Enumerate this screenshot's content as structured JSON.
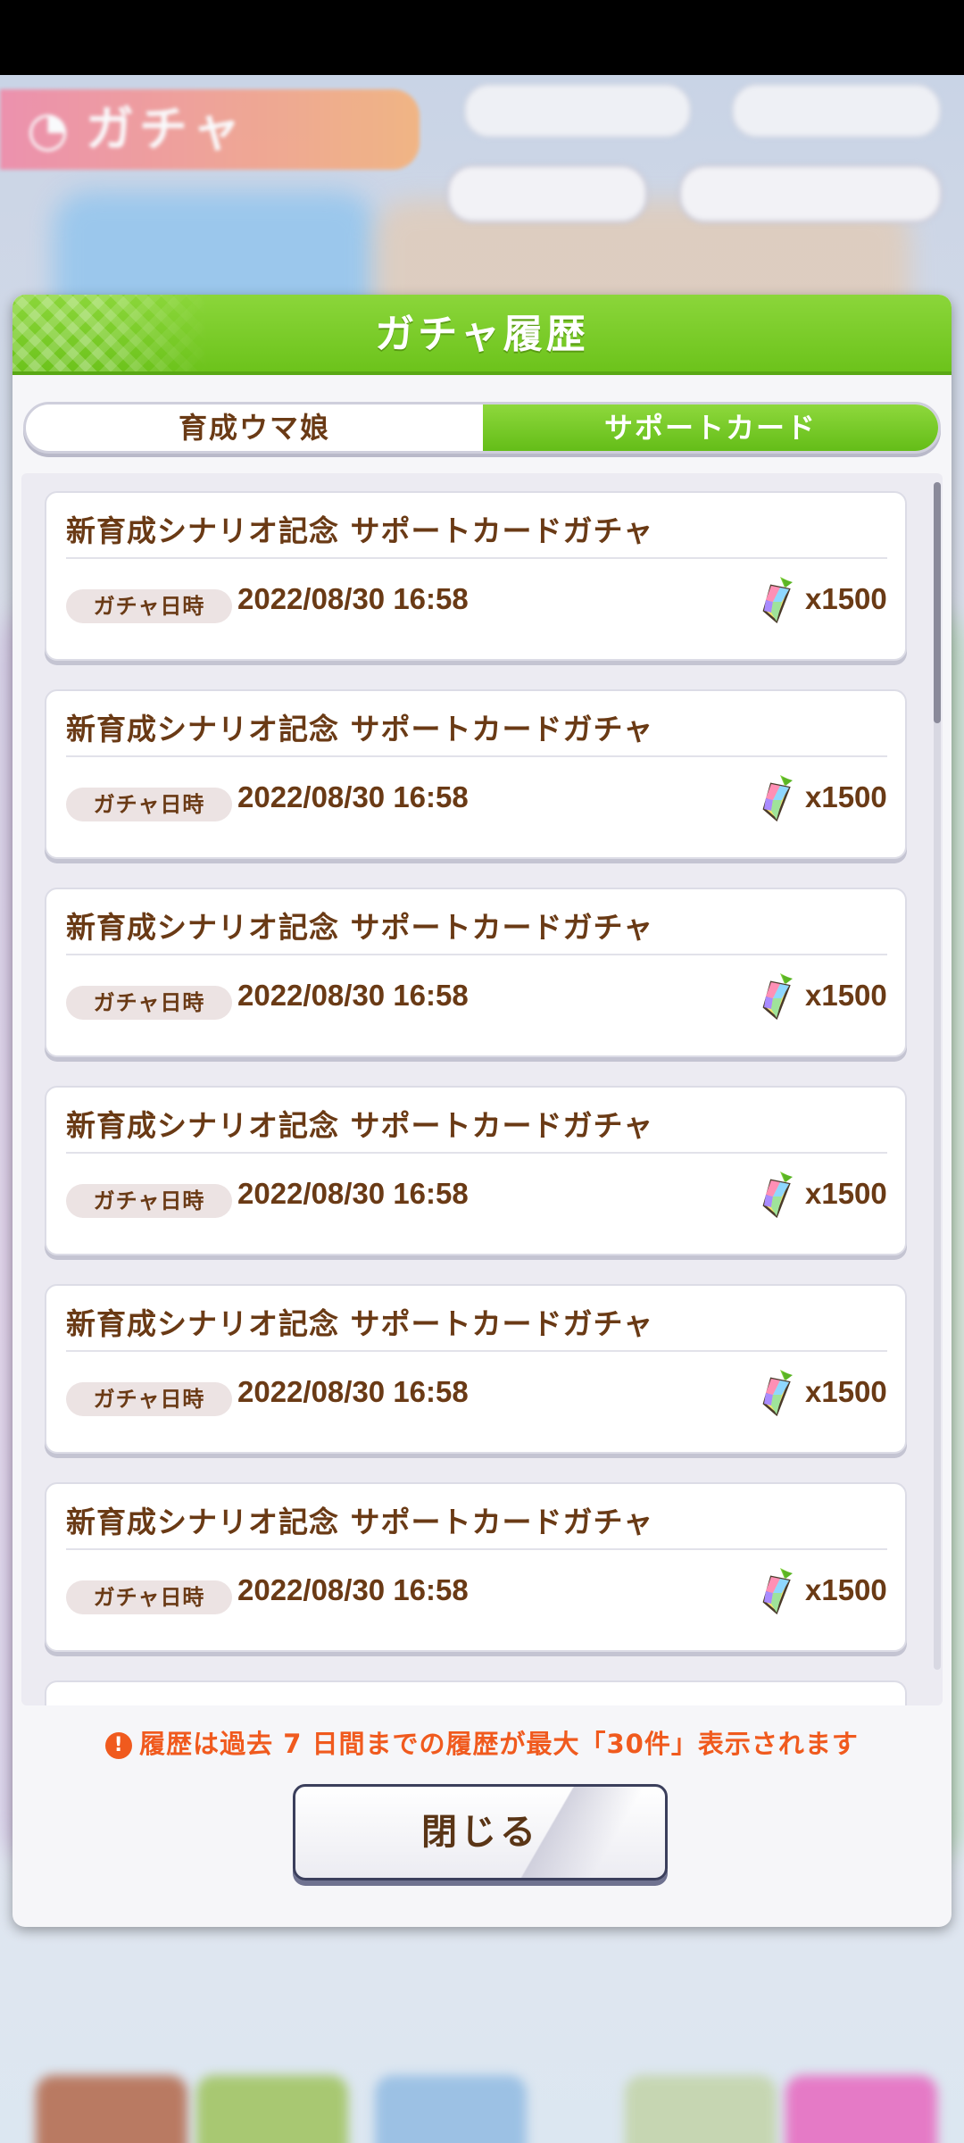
{
  "background": {
    "screen_title": "ガチャ"
  },
  "modal": {
    "title": "ガチャ履歴",
    "tabs": [
      {
        "label": "育成ウマ娘",
        "active": false
      },
      {
        "label": "サポートカード",
        "active": true
      }
    ],
    "history_items": [
      {
        "title": "新育成シナリオ記念 サポートカードガチャ",
        "date_label": "ガチャ日時",
        "datetime": "2022/08/30 16:58",
        "cost": "x1500",
        "cost_icon": "carrot-jewel-icon"
      },
      {
        "title": "新育成シナリオ記念 サポートカードガチャ",
        "date_label": "ガチャ日時",
        "datetime": "2022/08/30 16:58",
        "cost": "x1500",
        "cost_icon": "carrot-jewel-icon"
      },
      {
        "title": "新育成シナリオ記念 サポートカードガチャ",
        "date_label": "ガチャ日時",
        "datetime": "2022/08/30 16:58",
        "cost": "x1500",
        "cost_icon": "carrot-jewel-icon"
      },
      {
        "title": "新育成シナリオ記念 サポートカードガチャ",
        "date_label": "ガチャ日時",
        "datetime": "2022/08/30 16:58",
        "cost": "x1500",
        "cost_icon": "carrot-jewel-icon"
      },
      {
        "title": "新育成シナリオ記念 サポートカードガチャ",
        "date_label": "ガチャ日時",
        "datetime": "2022/08/30 16:58",
        "cost": "x1500",
        "cost_icon": "carrot-jewel-icon"
      },
      {
        "title": "新育成シナリオ記念 サポートカードガチャ",
        "date_label": "ガチャ日時",
        "datetime": "2022/08/30 16:58",
        "cost": "x1500",
        "cost_icon": "carrot-jewel-icon"
      }
    ],
    "notice": "履歴は過去 7 日間までの履歴が最大「30件」表示されます",
    "notice_icon": "!",
    "close_label": "閉じる"
  },
  "colors": {
    "header_green": "#6bc21a",
    "text_brown": "#6a3a15",
    "notice_orange": "#f05a1e"
  }
}
